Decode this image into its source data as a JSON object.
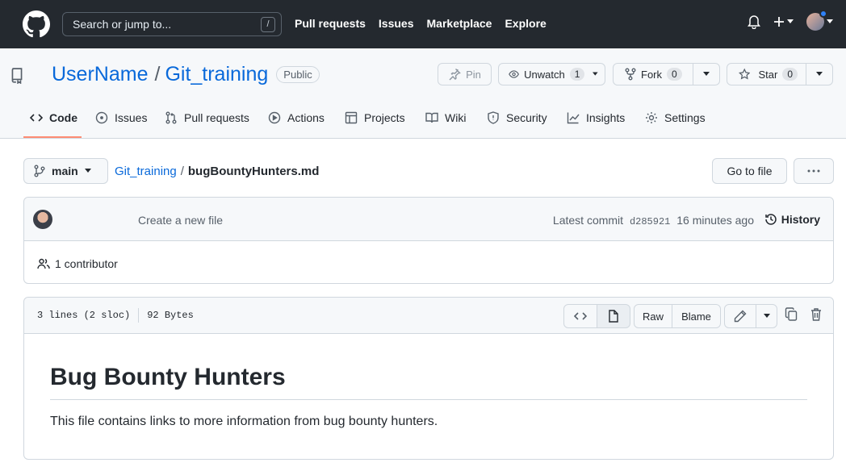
{
  "header": {
    "search_placeholder": "Search or jump to...",
    "search_shortcut": "/",
    "nav": [
      "Pull requests",
      "Issues",
      "Marketplace",
      "Explore"
    ]
  },
  "repo": {
    "owner": "UserName",
    "separator": "/",
    "name": "Git_training",
    "visibility": "Public",
    "pin_label": "Pin",
    "watch_label": "Unwatch",
    "watch_count": "1",
    "fork_label": "Fork",
    "fork_count": "0",
    "star_label": "Star",
    "star_count": "0"
  },
  "tabs": [
    {
      "label": "Code",
      "icon": "code-icon"
    },
    {
      "label": "Issues",
      "icon": "issue-icon"
    },
    {
      "label": "Pull requests",
      "icon": "pull-request-icon"
    },
    {
      "label": "Actions",
      "icon": "play-icon"
    },
    {
      "label": "Projects",
      "icon": "table-icon"
    },
    {
      "label": "Wiki",
      "icon": "book-icon"
    },
    {
      "label": "Security",
      "icon": "shield-icon"
    },
    {
      "label": "Insights",
      "icon": "graph-icon"
    },
    {
      "label": "Settings",
      "icon": "gear-icon"
    }
  ],
  "file_nav": {
    "branch": "main",
    "breadcrumb_repo": "Git_training",
    "breadcrumb_sep": "/",
    "file_name": "bugBountyHunters.md",
    "go_to_file": "Go to file"
  },
  "commit": {
    "message": "Create a new file",
    "latest_label": "Latest commit",
    "sha": "d285921",
    "time": "16 minutes ago",
    "history_label": "History",
    "contributors": "1 contributor"
  },
  "file": {
    "lines": "3 lines (2 sloc)",
    "size": "92 Bytes",
    "raw_label": "Raw",
    "blame_label": "Blame"
  },
  "readme": {
    "heading": "Bug Bounty Hunters",
    "body": "This file contains links to more information from bug bounty hunters."
  },
  "colors": {
    "header_bg": "#24292f",
    "link": "#0969da",
    "active_tab_underline": "#fd8c73"
  }
}
